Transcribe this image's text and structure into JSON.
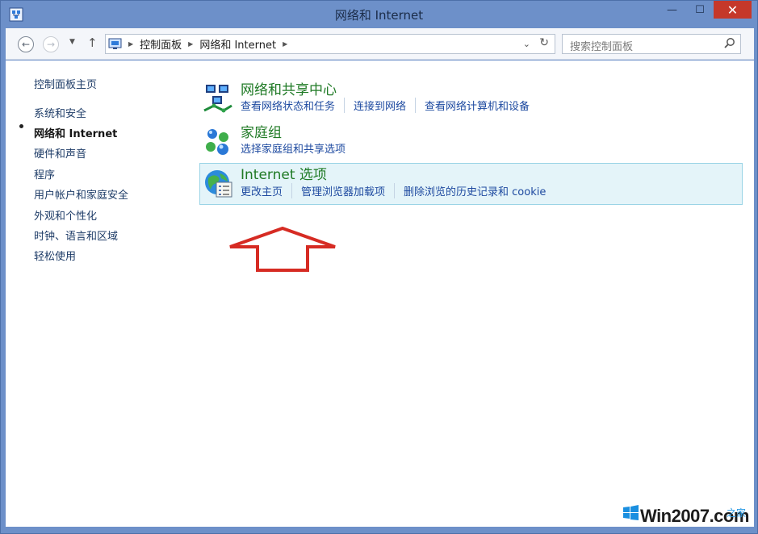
{
  "window": {
    "title": "网络和 Internet",
    "controls": {
      "minimize": "—",
      "maximize": "☐",
      "close": "✕"
    },
    "close_color": "#c5382a"
  },
  "address_bar": {
    "back_icon": "back-arrow-icon",
    "forward_icon": "forward-arrow-icon",
    "up_icon": "up-arrow-icon",
    "breadcrumb": [
      "控制面板",
      "网络和 Internet"
    ],
    "search_placeholder": "搜索控制面板"
  },
  "sidebar": {
    "home": "控制面板主页",
    "items": [
      {
        "label": "系统和安全",
        "active": false
      },
      {
        "label": "网络和 Internet",
        "active": true
      },
      {
        "label": "硬件和声音",
        "active": false
      },
      {
        "label": "程序",
        "active": false
      },
      {
        "label": "用户帐户和家庭安全",
        "active": false
      },
      {
        "label": "外观和个性化",
        "active": false
      },
      {
        "label": "时钟、语言和区域",
        "active": false
      },
      {
        "label": "轻松使用",
        "active": false
      }
    ]
  },
  "categories": [
    {
      "title": "网络和共享中心",
      "icon": "network-sharing-center-icon",
      "links": [
        "查看网络状态和任务",
        "连接到网络",
        "查看网络计算机和设备"
      ],
      "selected": false
    },
    {
      "title": "家庭组",
      "icon": "homegroup-icon",
      "links": [
        "选择家庭组和共享选项"
      ],
      "selected": false
    },
    {
      "title": "Internet 选项",
      "icon": "internet-options-icon",
      "links": [
        "更改主页",
        "管理浏览器加载项",
        "删除浏览的历史记录和 cookie"
      ],
      "selected": true
    }
  ],
  "annotation": {
    "icon": "red-up-arrow",
    "color": "#d62b23"
  },
  "watermark": {
    "text": "Win2007.com",
    "tail": "之家"
  },
  "colors": {
    "accent_green": "#1f7a25",
    "link_blue": "#1e4aa0",
    "selection_bg": "#e4f4f9",
    "frame_blue": "#6d90c9"
  }
}
